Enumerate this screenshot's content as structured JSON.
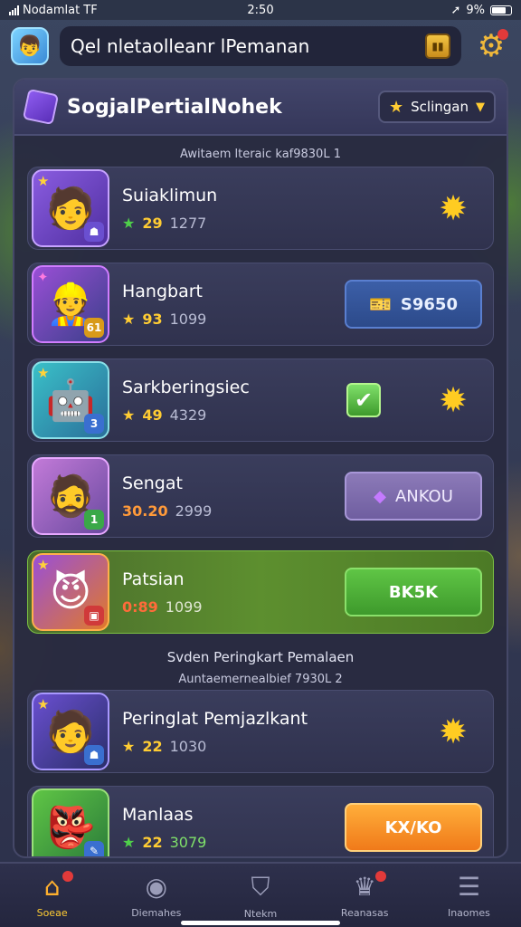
{
  "status": {
    "carrier": "Nodamlat",
    "time": "2:50",
    "battery": "9%"
  },
  "topbar": {
    "title": "Qel nletaolleanr lPemanan"
  },
  "panel": {
    "title": "SogjalPertialNohek",
    "season_label": "Sclingan",
    "section1_label": "Awitaem lteraic kaf9830L 1",
    "section2_title": "Svden Peringkart Pemalaen",
    "section2_label": "Auntaemernealbief 7930L 2"
  },
  "rows": [
    {
      "name": "Suiaklimun",
      "level": "29",
      "score": "1277",
      "action": ""
    },
    {
      "name": "Hangbart",
      "level": "93",
      "score": "1099",
      "action": "S9650"
    },
    {
      "name": "Sarkberingsiec",
      "level": "49",
      "score": "4329",
      "action": ""
    },
    {
      "name": "Sengat",
      "level": "30.20",
      "score": "2999",
      "action": "ANKOU"
    },
    {
      "name": "Patsian",
      "level": "0:89",
      "score": "1099",
      "action": "BK5K"
    },
    {
      "name": "Peringlat Pemjazlkant",
      "level": "22",
      "score": "1030",
      "action": ""
    },
    {
      "name": "Manlaas",
      "level": "22",
      "score": "3079",
      "action": "KX/KO"
    }
  ],
  "nav": [
    {
      "label": "Soeae",
      "icon": "home-icon"
    },
    {
      "label": "Diemahes",
      "icon": "target-icon"
    },
    {
      "label": "Ntekm",
      "icon": "shield-icon"
    },
    {
      "label": "Reanasas",
      "icon": "trophy-icon"
    },
    {
      "label": "Inaomes",
      "icon": "menu-icon"
    }
  ]
}
